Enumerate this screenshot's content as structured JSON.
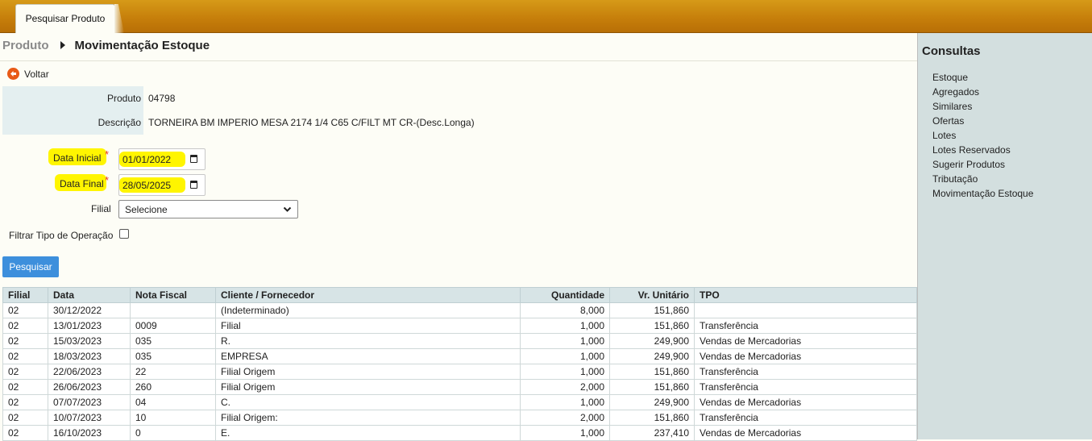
{
  "tab": {
    "label": "Pesquisar Produto"
  },
  "breadcrumb": {
    "root": "Produto",
    "current": "Movimentação Estoque"
  },
  "back": {
    "label": "Voltar"
  },
  "product": {
    "code_label": "Produto",
    "code": "04798",
    "desc_label": "Descrição",
    "desc": "TORNEIRA BM IMPERIO MESA 2174 1/4 C65 C/FILT MT CR-(Desc.Longa)"
  },
  "form": {
    "start_label": "Data Inicial",
    "start_value": "01/01/2022",
    "end_label": "Data Final",
    "end_value": "28/05/2025",
    "required_mark": "*",
    "branch_label": "Filial",
    "branch_value": "Selecione",
    "filter_label": "Filtrar Tipo de Operação",
    "filter_checked": false,
    "search_button": "Pesquisar"
  },
  "table": {
    "headers": [
      "Filial",
      "Data",
      "Nota Fiscal",
      "Cliente / Fornecedor",
      "Quantidade",
      "Vr. Unitário",
      "TPO"
    ],
    "rows": [
      [
        "02",
        "30/12/2022",
        "",
        "(Indeterminado)",
        "8,000",
        "151,860",
        ""
      ],
      [
        "02",
        "13/01/2023",
        "0009",
        "Filial",
        "1,000",
        "151,860",
        "Transferência"
      ],
      [
        "02",
        "15/03/2023",
        "035",
        "R.",
        "1,000",
        "249,900",
        "Vendas de Mercadorias"
      ],
      [
        "02",
        "18/03/2023",
        "035",
        "EMPRESA",
        "1,000",
        "249,900",
        "Vendas de Mercadorias"
      ],
      [
        "02",
        "22/06/2023",
        "22",
        "Filial Origem",
        "1,000",
        "151,860",
        "Transferência"
      ],
      [
        "02",
        "26/06/2023",
        "260",
        "Filial Origem",
        "2,000",
        "151,860",
        "Transferência"
      ],
      [
        "02",
        "07/07/2023",
        "04",
        "C.",
        "1,000",
        "249,900",
        "Vendas de Mercadorias"
      ],
      [
        "02",
        "10/07/2023",
        "10",
        "Filial Origem:",
        "2,000",
        "151,860",
        "Transferência"
      ],
      [
        "02",
        "16/10/2023",
        "0",
        "E.",
        "1,000",
        "237,410",
        "Vendas de Mercadorias"
      ]
    ]
  },
  "sidebar": {
    "title": "Consultas",
    "items": [
      "Estoque",
      "Agregados",
      "Similares",
      "Ofertas",
      "Lotes",
      "Lotes Reservados",
      "Sugerir Produtos",
      "Tributação",
      "Movimentação Estoque"
    ]
  },
  "colors": {
    "accent_bar": "#c57d0a",
    "button": "#3d8fdc",
    "highlight": "#fff500",
    "sidebar": "#d3dfdf"
  }
}
